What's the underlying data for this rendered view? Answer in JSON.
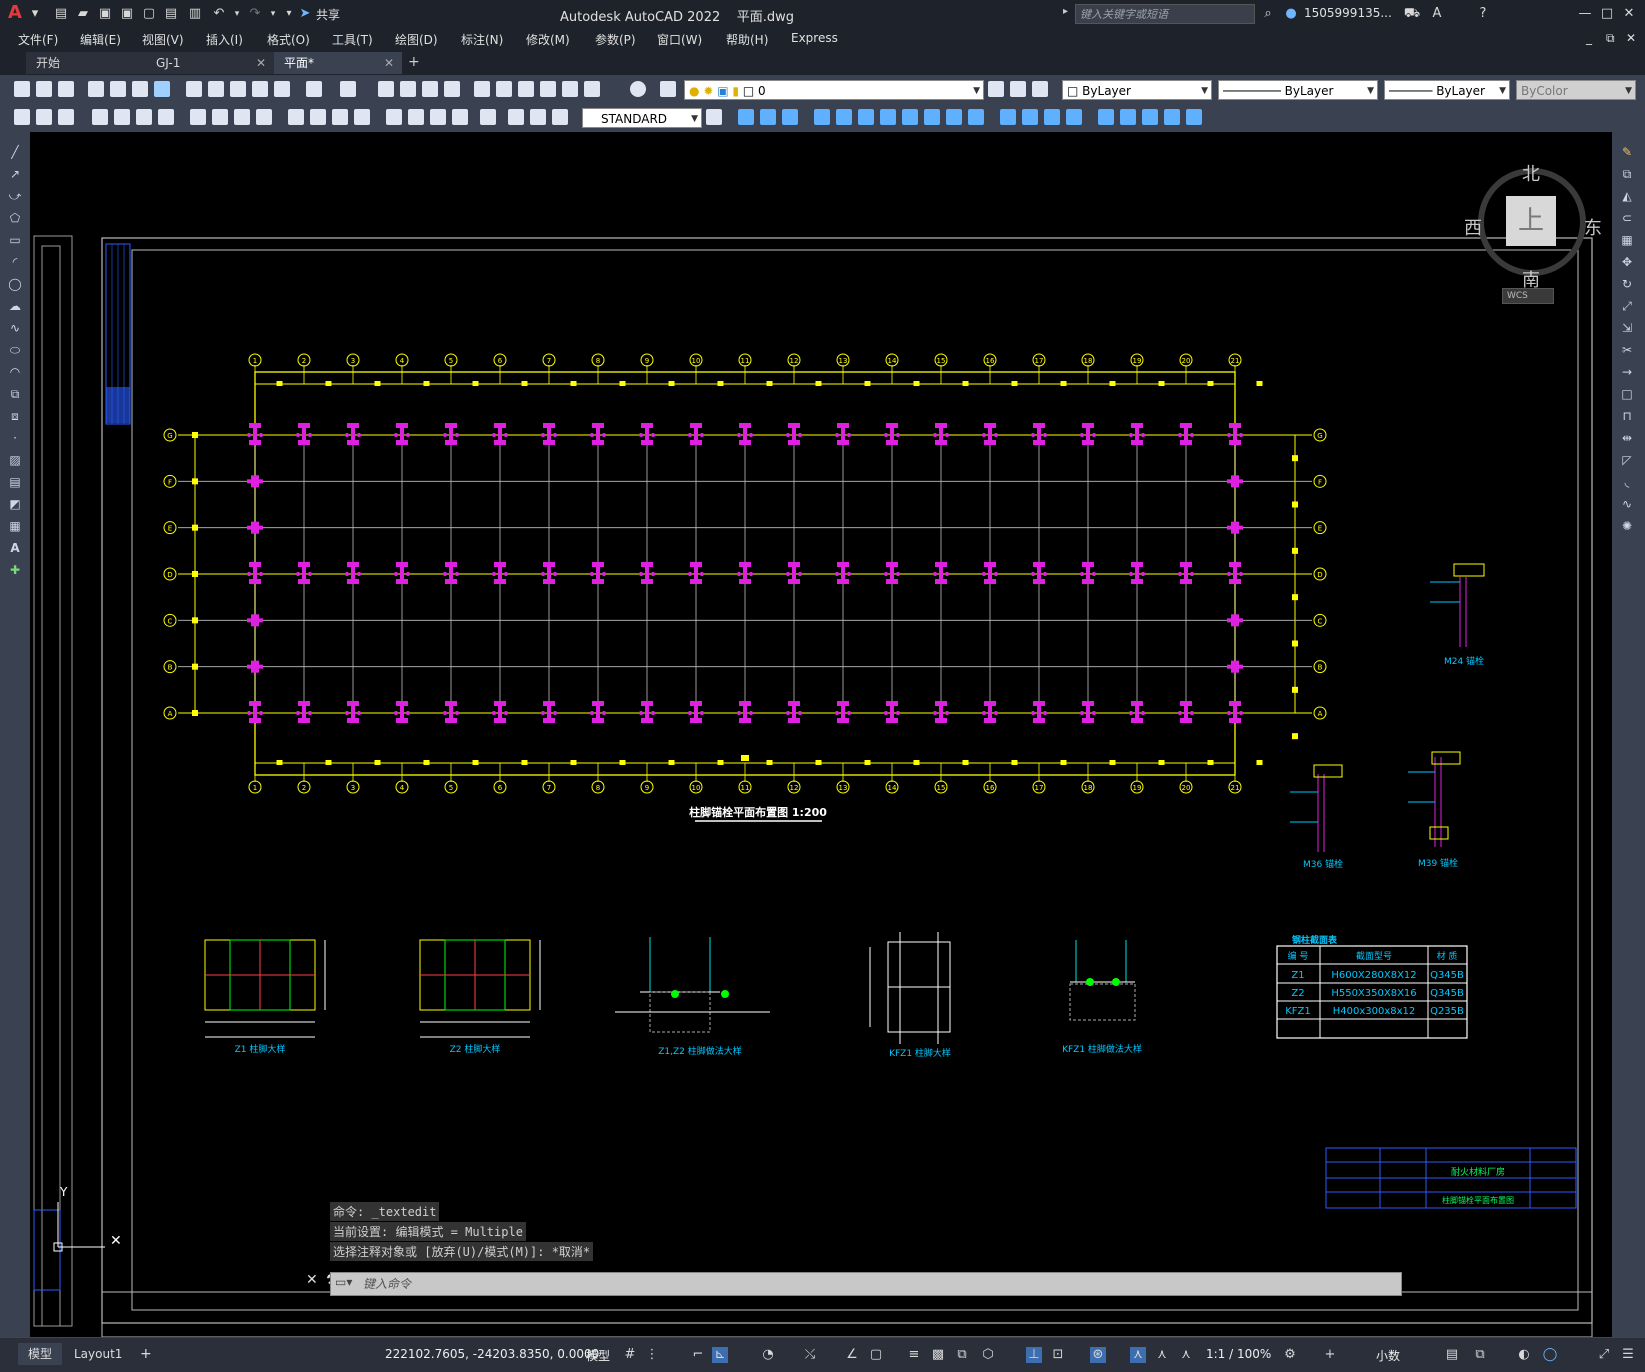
{
  "app": {
    "title": "Autodesk AutoCAD 2022",
    "filename": "平面.dwg",
    "share_label": "共享",
    "search_placeholder": "键入关键字或短语",
    "user": "1505999135...",
    "logo": "A"
  },
  "menu": [
    "文件(F)",
    "编辑(E)",
    "视图(V)",
    "插入(I)",
    "格式(O)",
    "工具(T)",
    "绘图(D)",
    "标注(N)",
    "修改(M)",
    "参数(P)",
    "窗口(W)",
    "帮助(H)",
    "Express"
  ],
  "tabs": [
    {
      "label": "开始"
    },
    {
      "label": "GJ-1"
    },
    {
      "label": "平面*"
    }
  ],
  "toolbar": {
    "layer_value": "0",
    "color_value": "ByLayer",
    "linetype_value": "ByLayer",
    "lineweight_value": "ByLayer",
    "plotstyle_value": "ByColor",
    "textstyle_value": "STANDARD"
  },
  "viewcube": {
    "north": "北",
    "south": "南",
    "east": "东",
    "west": "西",
    "top": "上",
    "wcs": "WCS"
  },
  "drawing": {
    "plan_title": "柱脚锚栓平面布置图 1:200",
    "col_numbers": [
      "1",
      "2",
      "3",
      "4",
      "5",
      "6",
      "7",
      "8",
      "9",
      "10",
      "11",
      "12",
      "13",
      "14",
      "15",
      "16",
      "17",
      "18",
      "19",
      "20",
      "21"
    ],
    "row_letters": [
      "G",
      "F",
      "E",
      "D",
      "C",
      "B",
      "A"
    ],
    "anchor_labels": [
      "M24 锚栓",
      "M36 锚栓",
      "M39 锚栓"
    ],
    "detail_labels": [
      "Z1 柱脚大样",
      "Z2 柱脚大样",
      "Z1,Z2 柱脚做法大样",
      "KFZ1 柱脚大样",
      "KFZ1 柱脚做法大样"
    ],
    "table": {
      "title": "钢柱截面表",
      "headers": [
        "编 号",
        "截面型号",
        "材 质"
      ],
      "rows": [
        [
          "Z1",
          "H600X280X8X12",
          "Q345B"
        ],
        [
          "Z2",
          "H550X350X8X16",
          "Q345B"
        ],
        [
          "KFZ1",
          "H400x300x8x12",
          "Q235B"
        ]
      ]
    },
    "titleblock": {
      "project": "耐火材料厂房",
      "drawing": "柱脚锚栓平面布置图"
    }
  },
  "command": {
    "history": [
      "命令: _textedit",
      "当前设置: 编辑模式 = Multiple",
      "选择注释对象或 [放弃(U)/模式(M)]: *取消*"
    ],
    "placeholder": "键入命令"
  },
  "status": {
    "tabs": [
      "模型",
      "Layout1"
    ],
    "coords": "222102.7605, -24203.8350, 0.0000",
    "model_label": "模型",
    "scale": "1:1 / 100%",
    "units": "小数"
  }
}
